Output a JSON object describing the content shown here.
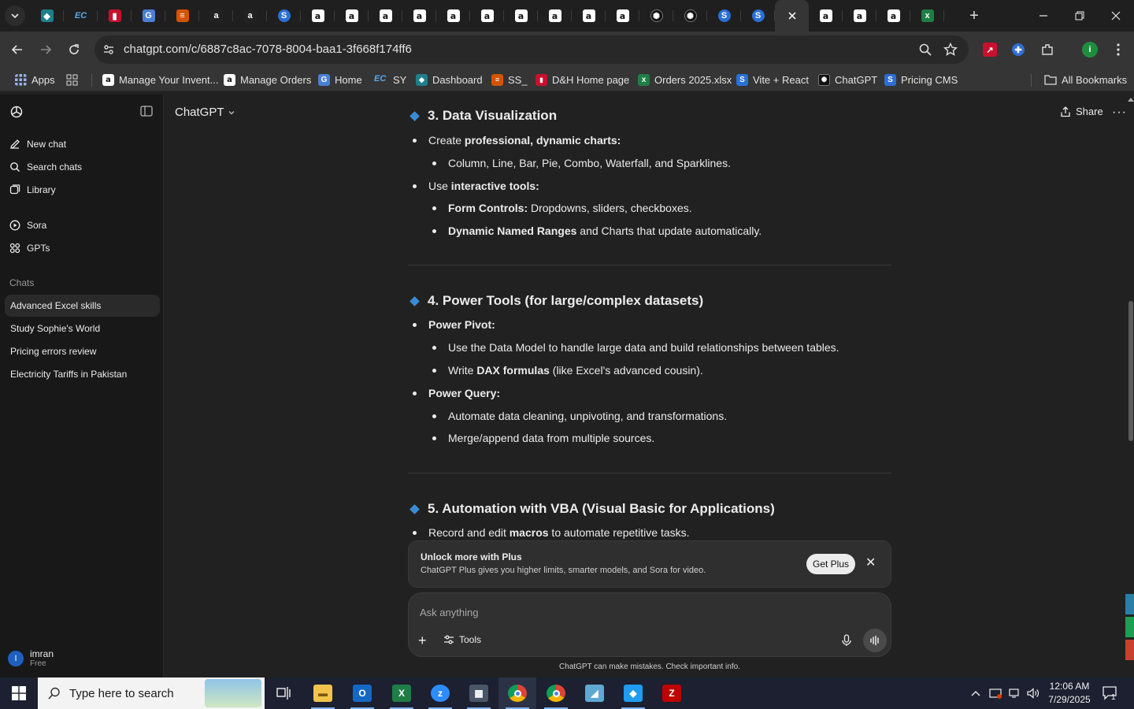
{
  "browser": {
    "tabs": [
      {
        "icon": "teal-app-icon"
      },
      {
        "icon": "ec-icon"
      },
      {
        "icon": "dh-icon"
      },
      {
        "icon": "g-icon"
      },
      {
        "icon": "stack-icon"
      },
      {
        "icon": "amazon-icon"
      },
      {
        "icon": "amazon-icon"
      },
      {
        "icon": "blue-s-icon"
      },
      {
        "icon": "amazon-icon"
      },
      {
        "icon": "amazon-icon"
      },
      {
        "icon": "amazon-icon"
      },
      {
        "icon": "amazon-icon"
      },
      {
        "icon": "amazon-icon"
      },
      {
        "icon": "amazon-icon"
      },
      {
        "icon": "amazon-icon"
      },
      {
        "icon": "amazon-icon"
      },
      {
        "icon": "amazon-icon"
      },
      {
        "icon": "amazon-icon"
      },
      {
        "icon": "openai-icon"
      },
      {
        "icon": "openai-icon"
      },
      {
        "icon": "blue-s-icon"
      },
      {
        "icon": "blue-s-icon"
      },
      {
        "icon": "close-icon",
        "active": true
      },
      {
        "icon": "amazon-icon"
      },
      {
        "icon": "amazon-icon"
      },
      {
        "icon": "amazon-icon"
      },
      {
        "icon": "excel-icon"
      }
    ],
    "url": "chatgpt.com/c/6887c8ac-7078-8004-baa1-3f668f174ff6",
    "bookmarks": [
      {
        "label": "Apps"
      },
      {
        "label": "Manage Your Invent..."
      },
      {
        "label": "Manage Orders"
      },
      {
        "label": "Home"
      },
      {
        "label": "SY"
      },
      {
        "label": "Dashboard"
      },
      {
        "label": "SS_"
      },
      {
        "label": "D&H Home page"
      },
      {
        "label": "Orders 2025.xlsx"
      },
      {
        "label": "Vite + React"
      },
      {
        "label": "ChatGPT"
      },
      {
        "label": "Pricing CMS"
      }
    ],
    "all_bookmarks": "All Bookmarks",
    "colors": {
      "accent": "#3a8bd6",
      "profile": "#1e8e3e"
    }
  },
  "sidebar": {
    "new_chat": "New chat",
    "search_chats": "Search chats",
    "library": "Library",
    "sora": "Sora",
    "gpts": "GPTs",
    "chats_heading": "Chats",
    "chats": [
      {
        "title": "Advanced Excel skills",
        "active": true
      },
      {
        "title": "Study Sophie's World"
      },
      {
        "title": "Pricing errors review"
      },
      {
        "title": "Electricity Tariffs in Pakistan"
      }
    ],
    "user": {
      "initial": "I",
      "name": "imran",
      "plan": "Free"
    }
  },
  "header": {
    "model": "ChatGPT",
    "share": "Share"
  },
  "content": {
    "sec3": {
      "title": "3. Data Visualization",
      "b1_pre": "Create ",
      "b1_bold": "professional, dynamic charts:",
      "b1_sub1": "Column, Line, Bar, Pie, Combo, Waterfall, and Sparklines.",
      "b2_pre": "Use ",
      "b2_bold": "interactive tools:",
      "b2_sub1_bold": "Form Controls:",
      "b2_sub1_rest": " Dropdowns, sliders, checkboxes.",
      "b2_sub2_bold": "Dynamic Named Ranges",
      "b2_sub2_rest": " and Charts that update automatically."
    },
    "sec4": {
      "title": "4. Power Tools (for large/complex datasets)",
      "b1_bold": "Power Pivot:",
      "b1_sub1": "Use the Data Model to handle large data and build relationships between tables.",
      "b1_sub2_pre": "Write ",
      "b1_sub2_bold": "DAX formulas",
      "b1_sub2_rest": " (like Excel's advanced cousin).",
      "b2_bold": "Power Query:",
      "b2_sub1": "Automate data cleaning, unpivoting, and transformations.",
      "b2_sub2": "Merge/append data from multiple sources."
    },
    "sec5": {
      "title": "5. Automation with VBA (Visual Basic for Applications)",
      "b1_pre": "Record and edit ",
      "b1_bold": "macros",
      "b1_rest": " to automate repetitive tasks."
    }
  },
  "upsell": {
    "title": "Unlock more with Plus",
    "subtitle": "ChatGPT Plus gives you higher limits, smarter models, and Sora for video.",
    "button": "Get Plus"
  },
  "composer": {
    "placeholder": "Ask anything",
    "value": "",
    "tools": "Tools"
  },
  "disclaimer": "ChatGPT can make mistakes. Check important info.",
  "taskbar": {
    "search_placeholder": "Type here to search",
    "time": "12:06 AM",
    "date": "7/29/2025",
    "notifications": "1"
  }
}
